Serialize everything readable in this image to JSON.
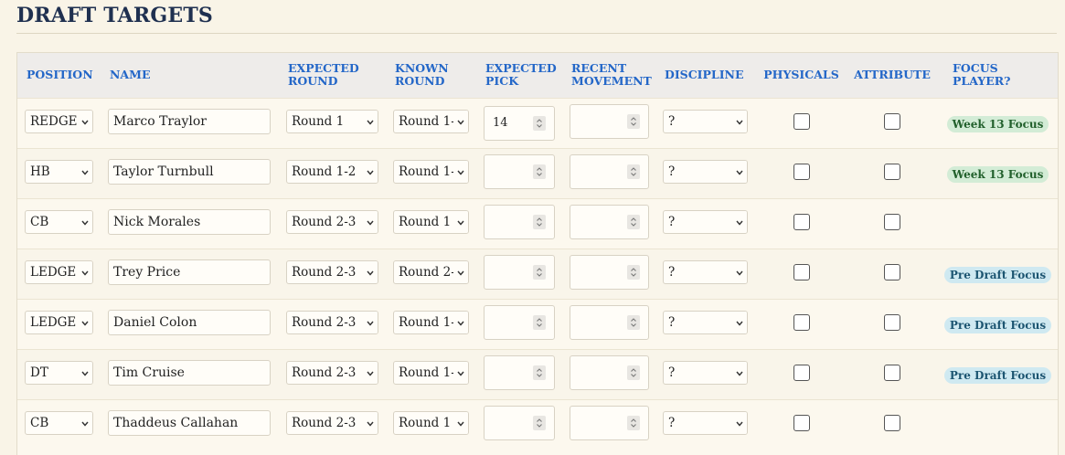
{
  "page": {
    "title": "DRAFT TARGETS"
  },
  "columns": {
    "position": "POSITION",
    "name": "NAME",
    "expected_round": [
      "EXPECTED",
      "ROUND"
    ],
    "known_round": [
      "KNOWN",
      "ROUND"
    ],
    "expected_pick": [
      "EXPECTED",
      "PICK"
    ],
    "recent_movement": [
      "RECENT",
      "MOVEMENT"
    ],
    "discipline": "DISCIPLINE",
    "physicals": "PHYSICALS",
    "attribute": "ATTRIBUTE",
    "focus_player": [
      "FOCUS",
      "PLAYER?"
    ]
  },
  "rows": [
    {
      "position": "REDGE",
      "name": "Marco Traylor",
      "expected_round": "Round 1",
      "known_round": "Round 1-",
      "expected_pick": "14",
      "recent_movement": "",
      "discipline": "?",
      "physicals": false,
      "attribute": false,
      "focus": "Week 13 Focus",
      "focus_type": "green"
    },
    {
      "position": "HB",
      "name": "Taylor Turnbull",
      "expected_round": "Round 1-2",
      "known_round": "Round 1-",
      "expected_pick": "",
      "recent_movement": "",
      "discipline": "?",
      "physicals": false,
      "attribute": false,
      "focus": "Week 13 Focus",
      "focus_type": "green"
    },
    {
      "position": "CB",
      "name": "Nick Morales",
      "expected_round": "Round 2-3",
      "known_round": "Round 1",
      "expected_pick": "",
      "recent_movement": "",
      "discipline": "?",
      "physicals": false,
      "attribute": false,
      "focus": "",
      "focus_type": ""
    },
    {
      "position": "LEDGE",
      "name": "Trey Price",
      "expected_round": "Round 2-3",
      "known_round": "Round 2-",
      "expected_pick": "",
      "recent_movement": "",
      "discipline": "?",
      "physicals": false,
      "attribute": false,
      "focus": "Pre Draft Focus",
      "focus_type": "blue"
    },
    {
      "position": "LEDGE",
      "name": "Daniel Colon",
      "expected_round": "Round 2-3",
      "known_round": "Round 1-",
      "expected_pick": "",
      "recent_movement": "",
      "discipline": "?",
      "physicals": false,
      "attribute": false,
      "focus": "Pre Draft Focus",
      "focus_type": "blue"
    },
    {
      "position": "DT",
      "name": "Tim Cruise",
      "expected_round": "Round 2-3",
      "known_round": "Round 1-",
      "expected_pick": "",
      "recent_movement": "",
      "discipline": "?",
      "physicals": false,
      "attribute": false,
      "focus": "Pre Draft Focus",
      "focus_type": "blue"
    },
    {
      "position": "CB",
      "name": "Thaddeus Callahan",
      "expected_round": "Round 2-3",
      "known_round": "Round 1",
      "expected_pick": "",
      "recent_movement": "",
      "discipline": "?",
      "physicals": false,
      "attribute": false,
      "focus": "",
      "focus_type": ""
    }
  ],
  "colors": {
    "page_bg": "#f9f4e7",
    "title": "#1f3050",
    "header_text": "#2467c8",
    "header_bg": "#eeecea",
    "badge_green_bg": "#d3ecd6",
    "badge_green_text": "#22602c",
    "badge_blue_bg": "#cfe9f1",
    "badge_blue_text": "#1c5571"
  },
  "icons": {
    "select_arrow": "chevron-down-icon",
    "spinner": "spinner-arrows-icon"
  }
}
